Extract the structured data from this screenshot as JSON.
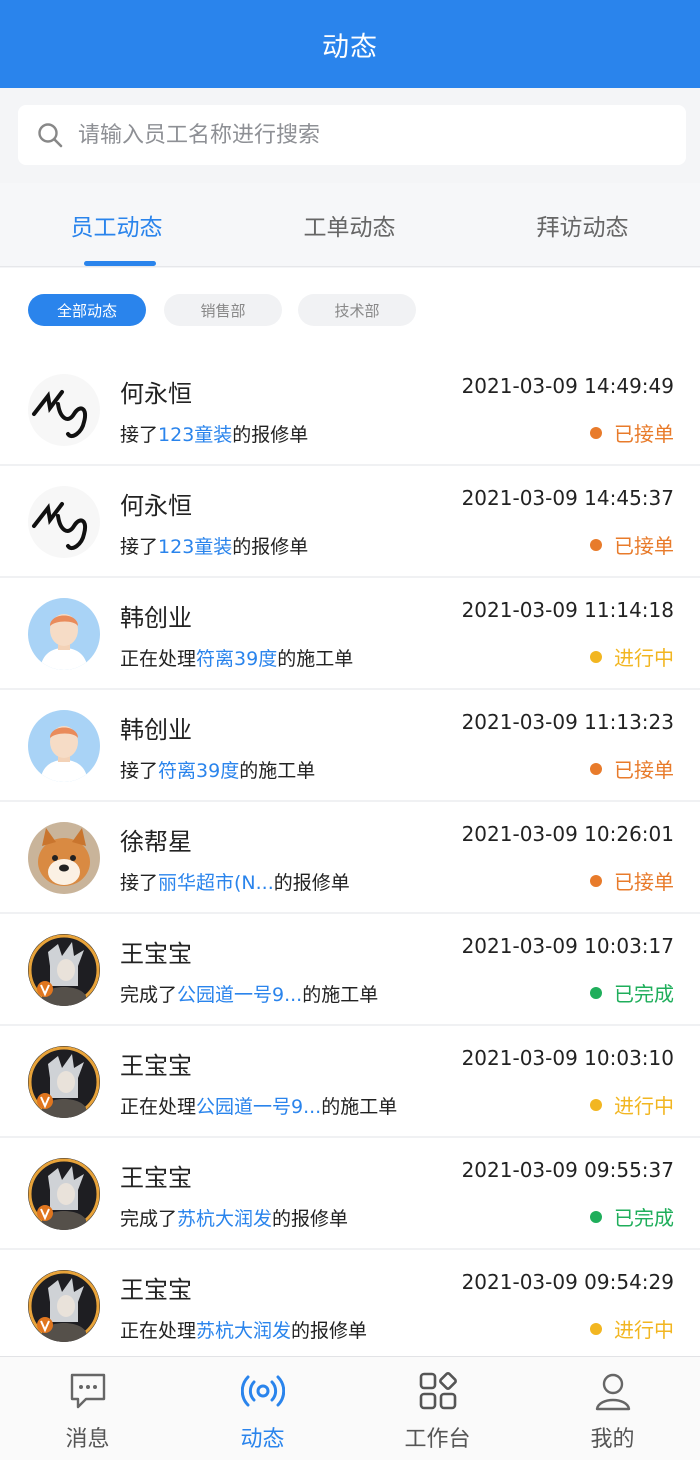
{
  "header": {
    "title": "动态"
  },
  "search": {
    "placeholder": "请输入员工名称进行搜索"
  },
  "tabs": [
    {
      "label": "员工动态"
    },
    {
      "label": "工单动态"
    },
    {
      "label": "拜访动态"
    }
  ],
  "filters": [
    {
      "label": "全部动态"
    },
    {
      "label": "销售部"
    },
    {
      "label": "技术部"
    }
  ],
  "colors": {
    "primary": "#2a84ec",
    "accepted": "#e87b2b",
    "in_progress": "#f2b621",
    "done": "#1fae5b"
  },
  "feed": [
    {
      "name": "何永恒",
      "time": "2021-03-09 14:49:49",
      "verb": "接了",
      "target": "123童装",
      "suffix": "的报修单",
      "status": "已接单",
      "avatar": "signature"
    },
    {
      "name": "何永恒",
      "time": "2021-03-09 14:45:37",
      "verb": "接了",
      "target": "123童装",
      "suffix": "的报修单",
      "status": "已接单",
      "avatar": "signature"
    },
    {
      "name": "韩创业",
      "time": "2021-03-09 11:14:18",
      "verb": "正在处理",
      "target": "符离39度",
      "suffix": "的施工单",
      "status": "进行中",
      "avatar": "default-person"
    },
    {
      "name": "韩创业",
      "time": "2021-03-09 11:13:23",
      "verb": "接了",
      "target": "符离39度",
      "suffix": "的施工单",
      "status": "已接单",
      "avatar": "default-person"
    },
    {
      "name": "徐帮星",
      "time": "2021-03-09 10:26:01",
      "verb": "接了",
      "target": "丽华超市(N...",
      "suffix": "的报修单",
      "status": "已接单",
      "avatar": "dog-photo"
    },
    {
      "name": "王宝宝",
      "time": "2021-03-09 10:03:17",
      "verb": "完成了",
      "target": "公园道一号9...",
      "suffix": "的施工单",
      "status": "已完成",
      "avatar": "anime-character"
    },
    {
      "name": "王宝宝",
      "time": "2021-03-09 10:03:10",
      "verb": "正在处理",
      "target": "公园道一号9...",
      "suffix": "的施工单",
      "status": "进行中",
      "avatar": "anime-character"
    },
    {
      "name": "王宝宝",
      "time": "2021-03-09 09:55:37",
      "verb": "完成了",
      "target": "苏杭大润发",
      "suffix": "的报修单",
      "status": "已完成",
      "avatar": "anime-character"
    },
    {
      "name": "王宝宝",
      "time": "2021-03-09 09:54:29",
      "verb": "正在处理",
      "target": "苏杭大润发",
      "suffix": "的报修单",
      "status": "进行中",
      "avatar": "anime-character"
    }
  ],
  "bottom_nav": [
    {
      "label": "消息",
      "icon": "message-icon"
    },
    {
      "label": "动态",
      "icon": "broadcast-icon"
    },
    {
      "label": "工作台",
      "icon": "apps-grid-icon"
    },
    {
      "label": "我的",
      "icon": "user-icon"
    }
  ]
}
